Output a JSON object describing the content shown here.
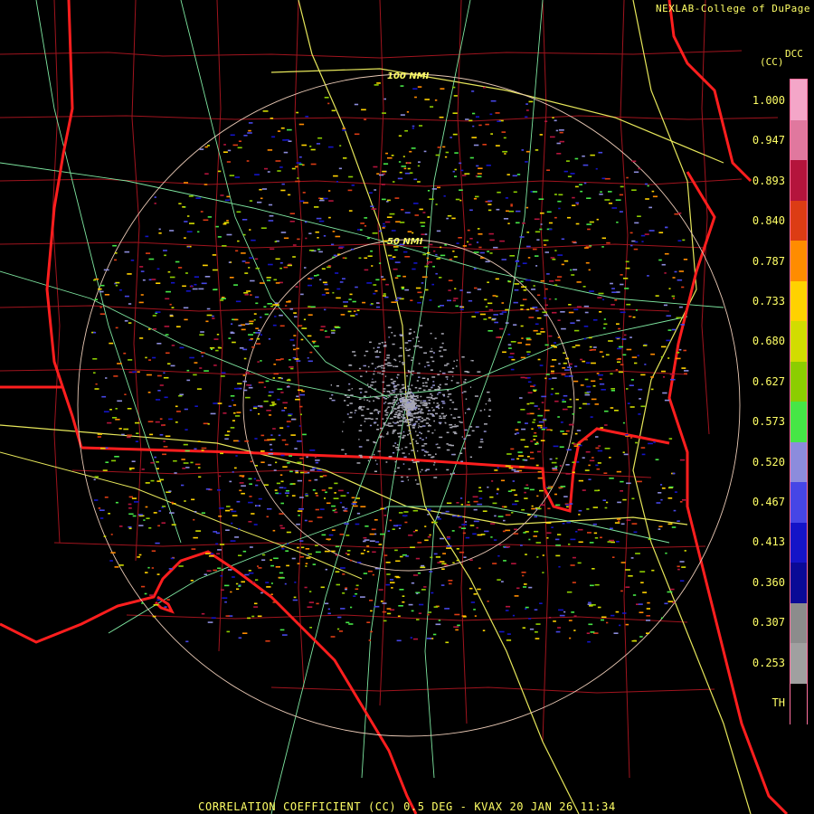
{
  "credit": "NEXLAB-College of DuPage",
  "product_short": "DCC",
  "product_unit": "CC",
  "rings": [
    {
      "label": "100 NMI",
      "range": 100
    },
    {
      "label": "50 NMI",
      "range": 50
    }
  ],
  "legend": {
    "ticks": [
      "1.000",
      "0.947",
      "0.893",
      "0.840",
      "0.787",
      "0.733",
      "0.680",
      "0.627",
      "0.573",
      "0.520",
      "0.467",
      "0.413",
      "0.360",
      "0.307",
      "0.253",
      "TH"
    ],
    "colors": [
      "#f4a6c8",
      "#e0789e",
      "#b4143c",
      "#dc3c14",
      "#ff8c00",
      "#ffd200",
      "#d2dc00",
      "#8ccd00",
      "#46e646",
      "#8c8cdc",
      "#4646e6",
      "#1414c8",
      "#0a0a96",
      "#8c8c8c",
      "#a0a0a0",
      "#000000"
    ]
  },
  "caption": "CORRELATION COEFFICIENT (CC) 0.5 DEG - KVAX 20 JAN 26 11:34",
  "radar_site": "KVAX"
}
